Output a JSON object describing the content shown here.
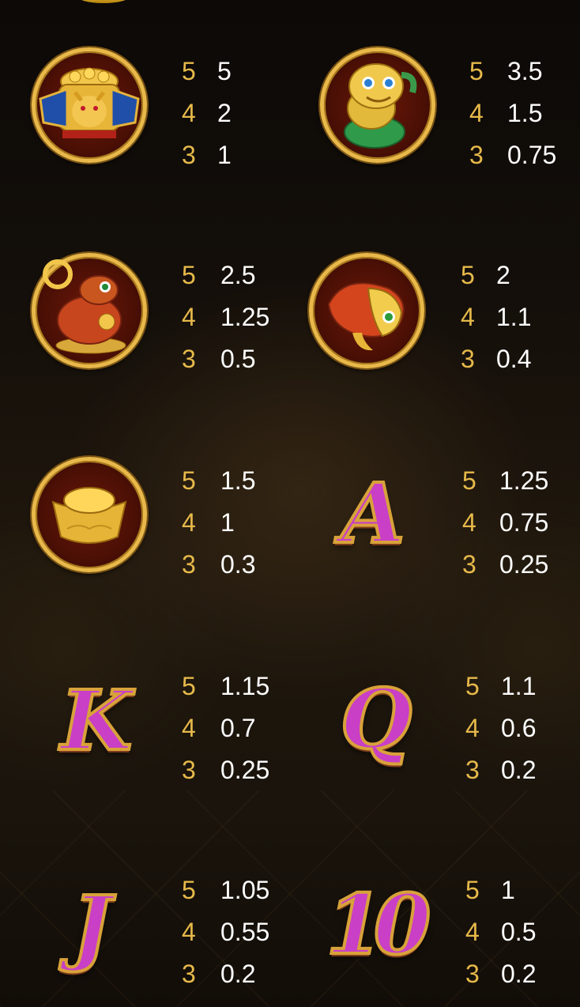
{
  "paytable": [
    {
      "symbol": "coin-pot-rat-symbol",
      "type": "icon",
      "pays": [
        {
          "count": "5",
          "value": "5"
        },
        {
          "count": "4",
          "value": "2"
        },
        {
          "count": "3",
          "value": "1"
        }
      ]
    },
    {
      "symbol": "jade-lion-symbol",
      "type": "icon",
      "pays": [
        {
          "count": "5",
          "value": "3.5"
        },
        {
          "count": "4",
          "value": "1.5"
        },
        {
          "count": "3",
          "value": "0.75"
        }
      ]
    },
    {
      "symbol": "money-toad-symbol",
      "type": "icon",
      "pays": [
        {
          "count": "5",
          "value": "2.5"
        },
        {
          "count": "4",
          "value": "1.25"
        },
        {
          "count": "3",
          "value": "0.5"
        }
      ]
    },
    {
      "symbol": "koi-fish-symbol",
      "type": "icon",
      "pays": [
        {
          "count": "5",
          "value": "2"
        },
        {
          "count": "4",
          "value": "1.1"
        },
        {
          "count": "3",
          "value": "0.4"
        }
      ]
    },
    {
      "symbol": "gold-ingot-symbol",
      "type": "icon",
      "pays": [
        {
          "count": "5",
          "value": "1.5"
        },
        {
          "count": "4",
          "value": "1"
        },
        {
          "count": "3",
          "value": "0.3"
        }
      ]
    },
    {
      "symbol": "letter-a-symbol",
      "type": "letter",
      "glyph": "A",
      "pays": [
        {
          "count": "5",
          "value": "1.25"
        },
        {
          "count": "4",
          "value": "0.75"
        },
        {
          "count": "3",
          "value": "0.25"
        }
      ]
    },
    {
      "symbol": "letter-k-symbol",
      "type": "letter",
      "glyph": "K",
      "pays": [
        {
          "count": "5",
          "value": "1.15"
        },
        {
          "count": "4",
          "value": "0.7"
        },
        {
          "count": "3",
          "value": "0.25"
        }
      ]
    },
    {
      "symbol": "letter-q-symbol",
      "type": "letter",
      "glyph": "Q",
      "pays": [
        {
          "count": "5",
          "value": "1.1"
        },
        {
          "count": "4",
          "value": "0.6"
        },
        {
          "count": "3",
          "value": "0.2"
        }
      ]
    },
    {
      "symbol": "letter-j-symbol",
      "type": "letter",
      "glyph": "J",
      "pays": [
        {
          "count": "5",
          "value": "1.05"
        },
        {
          "count": "4",
          "value": "0.55"
        },
        {
          "count": "3",
          "value": "0.2"
        }
      ]
    },
    {
      "symbol": "number-10-symbol",
      "type": "letter",
      "glyph": "10",
      "pays": [
        {
          "count": "5",
          "value": "1"
        },
        {
          "count": "4",
          "value": "0.5"
        },
        {
          "count": "3",
          "value": "0.2"
        }
      ]
    }
  ],
  "colors": {
    "count": "#e6b94a",
    "value": "#ffffff",
    "gold_frame": "#e8b84a",
    "letter": "#c93fc6"
  }
}
